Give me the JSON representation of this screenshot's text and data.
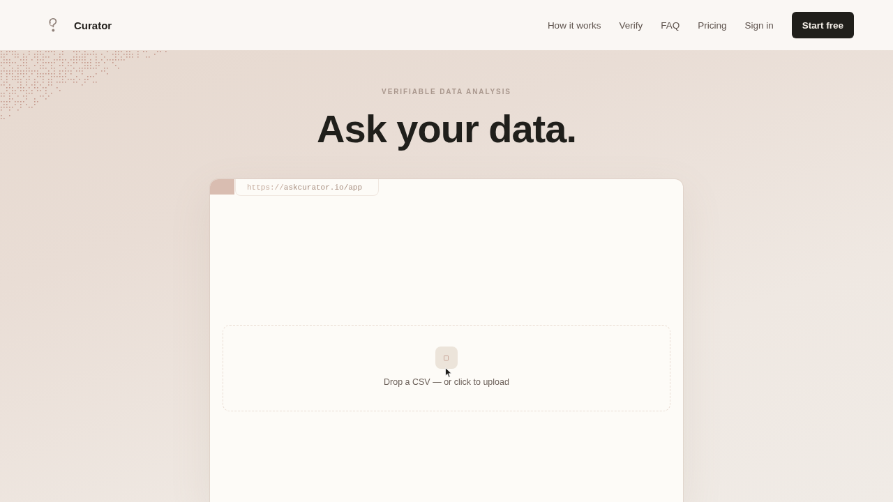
{
  "header": {
    "brand": "Curator",
    "nav": [
      "How it works",
      "Verify",
      "FAQ",
      "Pricing",
      "Sign in"
    ],
    "cta": "Start free"
  },
  "hero": {
    "eyebrow": "VERIFIABLE DATA ANALYSIS",
    "title": "Ask your data."
  },
  "app_preview": {
    "url": {
      "scheme": "https://",
      "path": "askcurator.io/app"
    },
    "dropzone": {
      "prompt": "Drop a CSV — or click to upload"
    }
  }
}
